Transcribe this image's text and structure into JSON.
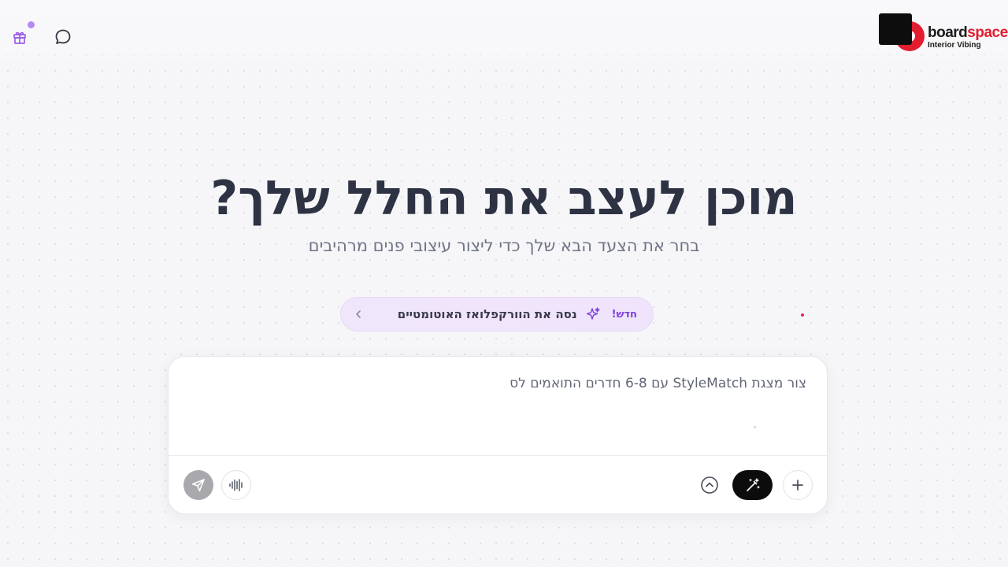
{
  "header": {
    "gift_icon": "gift-icon",
    "chat_icon": "chat-bubble-icon",
    "notification_dot_color": "#b48cf0"
  },
  "logo": {
    "name_part1": "board",
    "name_part2": "space",
    "tagline": "Interior Vibing",
    "brand_color": "#e11d2f"
  },
  "hero": {
    "title": "מוכן לעצב את החלל שלך?",
    "subtitle": "בחר את הצעד הבא שלך כדי ליצור עיצובי פנים מרהיבים"
  },
  "promo": {
    "badge": "חדש!",
    "text": "נסה את הוורקפלואז האוטומטיים",
    "icon": "sparkles-icon",
    "chevron_icon": "chevron-left-icon",
    "accent_color": "#7d3fe0"
  },
  "composer": {
    "placeholder": "צור מצגת StyleMatch עם 6-8 חדרים התואמים לס",
    "value": "",
    "buttons": {
      "send": "send-icon",
      "voice": "waveform-icon",
      "expand": "chevron-up-circle-icon",
      "magic": "magic-wand-icon",
      "add": "plus-icon"
    }
  }
}
